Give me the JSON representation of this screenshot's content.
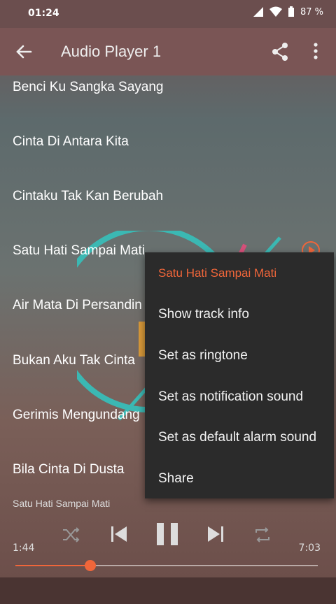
{
  "status": {
    "time": "01:24",
    "battery": "87 %"
  },
  "appbar": {
    "title": "Audio Player 1"
  },
  "tracks": [
    "Benci Ku Sangka Sayang",
    "Cinta Di Antara Kita",
    "Cintaku Tak Kan Berubah",
    "Satu Hati Sampai Mati",
    "Air Mata Di Persandin",
    "Bukan Aku Tak Cinta",
    "Gerimis Mengundang",
    "Bila Cinta Di Dusta"
  ],
  "menu": {
    "header": "Satu Hati Sampai Mati",
    "items": [
      "Show track info",
      "Set as ringtone",
      "Set as notification sound",
      "Set as default alarm sound",
      "Share"
    ]
  },
  "player": {
    "now_playing": "Satu Hati Sampai Mati",
    "current_time": "1:44",
    "total_time": "7:03",
    "progress": 0.247
  },
  "colors": {
    "accent": "#f0663a",
    "menu_bg": "#2b2b2b",
    "appbar": "#7a5555"
  }
}
